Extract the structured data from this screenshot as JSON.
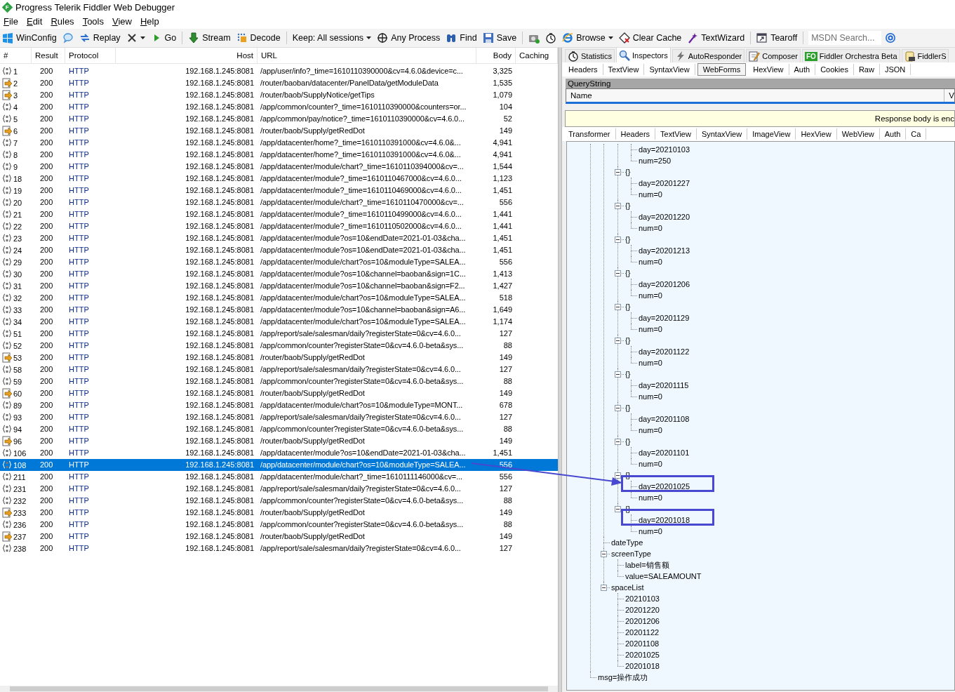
{
  "window": {
    "title": "Progress Telerik Fiddler Web Debugger",
    "icon_text": "F"
  },
  "menu": [
    "File",
    "Edit",
    "Rules",
    "Tools",
    "View",
    "Help"
  ],
  "toolbar": [
    {
      "kind": "button",
      "label": "WinConfig",
      "dropdown": false
    },
    {
      "kind": "button",
      "dropdown": false
    },
    {
      "kind": "button",
      "label": "Replay",
      "dropdown": false
    },
    {
      "kind": "button",
      "dropdown": true
    },
    {
      "kind": "button",
      "label": "Go",
      "dropdown": false
    },
    {
      "kind": "separator"
    },
    {
      "kind": "button",
      "label": "Stream",
      "dropdown": false
    },
    {
      "kind": "button",
      "label": "Decode",
      "dropdown": false
    },
    {
      "kind": "separator"
    },
    {
      "kind": "button",
      "label": "Keep: All sessions",
      "dropdown": true
    },
    {
      "kind": "button",
      "label": "Any Process",
      "dropdown": false
    },
    {
      "kind": "button",
      "label": "Find",
      "dropdown": false
    },
    {
      "kind": "button",
      "label": "Save",
      "dropdown": false
    },
    {
      "kind": "separator"
    },
    {
      "kind": "button",
      "dropdown": false
    },
    {
      "kind": "button",
      "dropdown": false
    },
    {
      "kind": "button",
      "label": "Browse",
      "dropdown": true
    },
    {
      "kind": "button",
      "label": "Clear Cache",
      "dropdown": false
    },
    {
      "kind": "button",
      "label": "TextWizard",
      "dropdown": false
    },
    {
      "kind": "separator"
    },
    {
      "kind": "button",
      "label": "Tearoff",
      "dropdown": false
    },
    {
      "kind": "separator"
    },
    {
      "kind": "search",
      "placeholder": "MSDN Search..."
    },
    {
      "kind": "button",
      "dropdown": false
    }
  ],
  "sessions": {
    "columns": [
      "#",
      "Result",
      "Protocol",
      "Host",
      "URL",
      "Body",
      "Caching"
    ],
    "rows": [
      {
        "kind": "script",
        "number": "1",
        "result": "200",
        "protocol": "HTTP",
        "host": "192.168.1.245:8081",
        "url": "/app/user/info?_time=1610110390000&cv=4.6.0&device=c...",
        "body": "3,325",
        "selected": false
      },
      {
        "kind": "response",
        "number": "2",
        "result": "200",
        "protocol": "HTTP",
        "host": "192.168.1.245:8081",
        "url": "/router/baoban/datacenter/PanelData/getModuleData",
        "body": "1,535",
        "selected": false
      },
      {
        "kind": "response",
        "number": "3",
        "result": "200",
        "protocol": "HTTP",
        "host": "192.168.1.245:8081",
        "url": "/router/baob/SupplyNotice/getTips",
        "body": "1,079",
        "selected": false
      },
      {
        "kind": "script",
        "number": "4",
        "result": "200",
        "protocol": "HTTP",
        "host": "192.168.1.245:8081",
        "url": "/app/common/counter?_time=1610110390000&counters=or...",
        "body": "104",
        "selected": false
      },
      {
        "kind": "script",
        "number": "5",
        "result": "200",
        "protocol": "HTTP",
        "host": "192.168.1.245:8081",
        "url": "/app/common/pay/notice?_time=1610110390000&cv=4.6.0...",
        "body": "52",
        "selected": false
      },
      {
        "kind": "response",
        "number": "6",
        "result": "200",
        "protocol": "HTTP",
        "host": "192.168.1.245:8081",
        "url": "/router/baob/Supply/getRedDot",
        "body": "149",
        "selected": false
      },
      {
        "kind": "script",
        "number": "7",
        "result": "200",
        "protocol": "HTTP",
        "host": "192.168.1.245:8081",
        "url": "/app/datacenter/home?_time=1610110391000&cv=4.6.0&...",
        "body": "4,941",
        "selected": false
      },
      {
        "kind": "script",
        "number": "8",
        "result": "200",
        "protocol": "HTTP",
        "host": "192.168.1.245:8081",
        "url": "/app/datacenter/home?_time=1610110391000&cv=4.6.0&...",
        "body": "4,941",
        "selected": false
      },
      {
        "kind": "script",
        "number": "9",
        "result": "200",
        "protocol": "HTTP",
        "host": "192.168.1.245:8081",
        "url": "/app/datacenter/module/chart?_time=1610110394000&cv=...",
        "body": "1,544",
        "selected": false
      },
      {
        "kind": "script",
        "number": "18",
        "result": "200",
        "protocol": "HTTP",
        "host": "192.168.1.245:8081",
        "url": "/app/datacenter/module?_time=1610110467000&cv=4.6.0...",
        "body": "1,123",
        "selected": false
      },
      {
        "kind": "script",
        "number": "19",
        "result": "200",
        "protocol": "HTTP",
        "host": "192.168.1.245:8081",
        "url": "/app/datacenter/module?_time=1610110469000&cv=4.6.0...",
        "body": "1,451",
        "selected": false
      },
      {
        "kind": "script",
        "number": "20",
        "result": "200",
        "protocol": "HTTP",
        "host": "192.168.1.245:8081",
        "url": "/app/datacenter/module/chart?_time=1610110470000&cv=...",
        "body": "556",
        "selected": false
      },
      {
        "kind": "script",
        "number": "21",
        "result": "200",
        "protocol": "HTTP",
        "host": "192.168.1.245:8081",
        "url": "/app/datacenter/module?_time=1610110499000&cv=4.6.0...",
        "body": "1,441",
        "selected": false
      },
      {
        "kind": "script",
        "number": "22",
        "result": "200",
        "protocol": "HTTP",
        "host": "192.168.1.245:8081",
        "url": "/app/datacenter/module?_time=1610110502000&cv=4.6.0...",
        "body": "1,441",
        "selected": false
      },
      {
        "kind": "script",
        "number": "23",
        "result": "200",
        "protocol": "HTTP",
        "host": "192.168.1.245:8081",
        "url": "/app/datacenter/module?os=10&endDate=2021-01-03&cha...",
        "body": "1,451",
        "selected": false
      },
      {
        "kind": "script",
        "number": "24",
        "result": "200",
        "protocol": "HTTP",
        "host": "192.168.1.245:8081",
        "url": "/app/datacenter/module?os=10&endDate=2021-01-03&cha...",
        "body": "1,451",
        "selected": false
      },
      {
        "kind": "script",
        "number": "29",
        "result": "200",
        "protocol": "HTTP",
        "host": "192.168.1.245:8081",
        "url": "/app/datacenter/module/chart?os=10&moduleType=SALEA...",
        "body": "556",
        "selected": false
      },
      {
        "kind": "script",
        "number": "30",
        "result": "200",
        "protocol": "HTTP",
        "host": "192.168.1.245:8081",
        "url": "/app/datacenter/module?os=10&channel=baoban&sign=1C...",
        "body": "1,413",
        "selected": false
      },
      {
        "kind": "script",
        "number": "31",
        "result": "200",
        "protocol": "HTTP",
        "host": "192.168.1.245:8081",
        "url": "/app/datacenter/module?os=10&channel=baoban&sign=F2...",
        "body": "1,427",
        "selected": false
      },
      {
        "kind": "script",
        "number": "32",
        "result": "200",
        "protocol": "HTTP",
        "host": "192.168.1.245:8081",
        "url": "/app/datacenter/module/chart?os=10&moduleType=SALEA...",
        "body": "518",
        "selected": false
      },
      {
        "kind": "script",
        "number": "33",
        "result": "200",
        "protocol": "HTTP",
        "host": "192.168.1.245:8081",
        "url": "/app/datacenter/module?os=10&channel=baoban&sign=A6...",
        "body": "1,649",
        "selected": false
      },
      {
        "kind": "script",
        "number": "34",
        "result": "200",
        "protocol": "HTTP",
        "host": "192.168.1.245:8081",
        "url": "/app/datacenter/module/chart?os=10&moduleType=SALEA...",
        "body": "1,174",
        "selected": false
      },
      {
        "kind": "script",
        "number": "51",
        "result": "200",
        "protocol": "HTTP",
        "host": "192.168.1.245:8081",
        "url": "/app/report/sale/salesman/daily?registerState=0&cv=4.6.0...",
        "body": "127",
        "selected": false
      },
      {
        "kind": "script",
        "number": "52",
        "result": "200",
        "protocol": "HTTP",
        "host": "192.168.1.245:8081",
        "url": "/app/common/counter?registerState=0&cv=4.6.0-beta&sys...",
        "body": "88",
        "selected": false
      },
      {
        "kind": "response",
        "number": "53",
        "result": "200",
        "protocol": "HTTP",
        "host": "192.168.1.245:8081",
        "url": "/router/baob/Supply/getRedDot",
        "body": "149",
        "selected": false
      },
      {
        "kind": "script",
        "number": "58",
        "result": "200",
        "protocol": "HTTP",
        "host": "192.168.1.245:8081",
        "url": "/app/report/sale/salesman/daily?registerState=0&cv=4.6.0...",
        "body": "127",
        "selected": false
      },
      {
        "kind": "script",
        "number": "59",
        "result": "200",
        "protocol": "HTTP",
        "host": "192.168.1.245:8081",
        "url": "/app/common/counter?registerState=0&cv=4.6.0-beta&sys...",
        "body": "88",
        "selected": false
      },
      {
        "kind": "response",
        "number": "60",
        "result": "200",
        "protocol": "HTTP",
        "host": "192.168.1.245:8081",
        "url": "/router/baob/Supply/getRedDot",
        "body": "149",
        "selected": false
      },
      {
        "kind": "script",
        "number": "89",
        "result": "200",
        "protocol": "HTTP",
        "host": "192.168.1.245:8081",
        "url": "/app/datacenter/module/chart?os=10&moduleType=MONT...",
        "body": "678",
        "selected": false
      },
      {
        "kind": "script",
        "number": "93",
        "result": "200",
        "protocol": "HTTP",
        "host": "192.168.1.245:8081",
        "url": "/app/report/sale/salesman/daily?registerState=0&cv=4.6.0...",
        "body": "127",
        "selected": false
      },
      {
        "kind": "script",
        "number": "94",
        "result": "200",
        "protocol": "HTTP",
        "host": "192.168.1.245:8081",
        "url": "/app/common/counter?registerState=0&cv=4.6.0-beta&sys...",
        "body": "88",
        "selected": false
      },
      {
        "kind": "response",
        "number": "96",
        "result": "200",
        "protocol": "HTTP",
        "host": "192.168.1.245:8081",
        "url": "/router/baob/Supply/getRedDot",
        "body": "149",
        "selected": false
      },
      {
        "kind": "script",
        "number": "106",
        "result": "200",
        "protocol": "HTTP",
        "host": "192.168.1.245:8081",
        "url": "/app/datacenter/module?os=10&endDate=2021-01-03&cha...",
        "body": "1,451",
        "selected": false
      },
      {
        "kind": "script",
        "number": "108",
        "result": "200",
        "protocol": "HTTP",
        "host": "192.168.1.245:8081",
        "url": "/app/datacenter/module/chart?os=10&moduleType=SALEA...",
        "body": "556",
        "selected": true
      },
      {
        "kind": "script",
        "number": "211",
        "result": "200",
        "protocol": "HTTP",
        "host": "192.168.1.245:8081",
        "url": "/app/datacenter/module/chart?_time=1610111146000&cv=...",
        "body": "556",
        "selected": false
      },
      {
        "kind": "script",
        "number": "231",
        "result": "200",
        "protocol": "HTTP",
        "host": "192.168.1.245:8081",
        "url": "/app/report/sale/salesman/daily?registerState=0&cv=4.6.0...",
        "body": "127",
        "selected": false
      },
      {
        "kind": "script",
        "number": "232",
        "result": "200",
        "protocol": "HTTP",
        "host": "192.168.1.245:8081",
        "url": "/app/common/counter?registerState=0&cv=4.6.0-beta&sys...",
        "body": "88",
        "selected": false
      },
      {
        "kind": "response",
        "number": "233",
        "result": "200",
        "protocol": "HTTP",
        "host": "192.168.1.245:8081",
        "url": "/router/baob/Supply/getRedDot",
        "body": "149",
        "selected": false
      },
      {
        "kind": "script",
        "number": "236",
        "result": "200",
        "protocol": "HTTP",
        "host": "192.168.1.245:8081",
        "url": "/app/common/counter?registerState=0&cv=4.6.0-beta&sys...",
        "body": "88",
        "selected": false
      },
      {
        "kind": "response",
        "number": "237",
        "result": "200",
        "protocol": "HTTP",
        "host": "192.168.1.245:8081",
        "url": "/router/baob/Supply/getRedDot",
        "body": "149",
        "selected": false
      },
      {
        "kind": "script",
        "number": "238",
        "result": "200",
        "protocol": "HTTP",
        "host": "192.168.1.245:8081",
        "url": "/app/report/sale/salesman/daily?registerState=0&cv=4.6.0...",
        "body": "127",
        "selected": false
      }
    ]
  },
  "inspector": {
    "tabs": [
      {
        "label": "Statistics",
        "selected": false
      },
      {
        "label": "Inspectors",
        "selected": true
      },
      {
        "label": "AutoResponder",
        "selected": false
      },
      {
        "label": "Composer",
        "selected": false
      },
      {
        "label": "Fiddler Orchestra Beta",
        "badge": "FO",
        "selected": false
      },
      {
        "label": "FiddlerS",
        "selected": false
      }
    ],
    "request_tabs": [
      {
        "label": "Headers",
        "selected": false
      },
      {
        "label": "TextView",
        "selected": false
      },
      {
        "label": "SyntaxView",
        "selected": false
      },
      {
        "label": "WebForms",
        "selected": true
      },
      {
        "label": "HexView",
        "selected": false
      },
      {
        "label": "Auth",
        "selected": false
      },
      {
        "label": "Cookies",
        "selected": false
      },
      {
        "label": "Raw",
        "selected": false
      },
      {
        "label": "JSON",
        "selected": false
      }
    ],
    "querystring": {
      "title": "QueryString",
      "columns": [
        "Name",
        "V"
      ]
    },
    "response_notice": "Response body is enc",
    "response_tabs": [
      {
        "label": "Transformer",
        "selected": false
      },
      {
        "label": "Headers",
        "selected": false
      },
      {
        "label": "TextView",
        "selected": false
      },
      {
        "label": "SyntaxView",
        "selected": false
      },
      {
        "label": "ImageView",
        "selected": false
      },
      {
        "label": "HexView",
        "selected": false
      },
      {
        "label": "WebView",
        "selected": false
      },
      {
        "label": "Auth",
        "selected": false
      },
      {
        "label": "Ca",
        "selected": false
      }
    ],
    "tree": [
      {
        "expanded": true,
        "children": [
          {
            "expanded": true,
            "children": [
              {
                "expanded": true,
                "children": [
                  {
                    "label": "day=20210103",
                    "annotated": false
                  },
                  {
                    "label": "num=250",
                    "annotated": false
                  }
                ]
              },
              {
                "label": "{}",
                "expanded": true,
                "children": [
                  {
                    "label": "day=20201227",
                    "annotated": false
                  },
                  {
                    "label": "num=0",
                    "annotated": false
                  }
                ]
              },
              {
                "label": "{}",
                "expanded": true,
                "children": [
                  {
                    "label": "day=20201220",
                    "annotated": false
                  },
                  {
                    "label": "num=0",
                    "annotated": false
                  }
                ]
              },
              {
                "label": "{}",
                "expanded": true,
                "children": [
                  {
                    "label": "day=20201213",
                    "annotated": false
                  },
                  {
                    "label": "num=0",
                    "annotated": false
                  }
                ]
              },
              {
                "label": "{}",
                "expanded": true,
                "children": [
                  {
                    "label": "day=20201206",
                    "annotated": false
                  },
                  {
                    "label": "num=0",
                    "annotated": false
                  }
                ]
              },
              {
                "label": "{}",
                "expanded": true,
                "children": [
                  {
                    "label": "day=20201129",
                    "annotated": false
                  },
                  {
                    "label": "num=0",
                    "annotated": false
                  }
                ]
              },
              {
                "label": "{}",
                "expanded": true,
                "children": [
                  {
                    "label": "day=20201122",
                    "annotated": false
                  },
                  {
                    "label": "num=0",
                    "annotated": false
                  }
                ]
              },
              {
                "label": "{}",
                "expanded": true,
                "children": [
                  {
                    "label": "day=20201115",
                    "annotated": false
                  },
                  {
                    "label": "num=0",
                    "annotated": false
                  }
                ]
              },
              {
                "label": "{}",
                "expanded": true,
                "children": [
                  {
                    "label": "day=20201108",
                    "annotated": false
                  },
                  {
                    "label": "num=0",
                    "annotated": false
                  }
                ]
              },
              {
                "label": "{}",
                "expanded": true,
                "children": [
                  {
                    "label": "day=20201101",
                    "annotated": false
                  },
                  {
                    "label": "num=0",
                    "annotated": false
                  }
                ]
              },
              {
                "label": "{}",
                "expanded": true,
                "children": [
                  {
                    "label": "day=20201025",
                    "annotated": true
                  },
                  {
                    "label": "num=0",
                    "annotated": false
                  }
                ]
              },
              {
                "label": "{}",
                "expanded": true,
                "children": [
                  {
                    "label": "day=20201018",
                    "annotated": true
                  },
                  {
                    "label": "num=0",
                    "annotated": false
                  }
                ]
              }
            ]
          },
          {
            "label": "dateType"
          },
          {
            "label": "screenType",
            "expanded": true,
            "children": [
              {
                "label": "label=销售额"
              },
              {
                "label": "value=SALEAMOUNT"
              }
            ]
          },
          {
            "label": "spaceList",
            "expanded": true,
            "children": [
              {
                "label": "20210103"
              },
              {
                "label": "20201220"
              },
              {
                "label": "20201206"
              },
              {
                "label": "20201122"
              },
              {
                "label": "20201108"
              },
              {
                "label": "20201025"
              },
              {
                "label": "20201018"
              }
            ]
          }
        ]
      },
      {
        "label": "msg=操作成功"
      }
    ]
  },
  "annotation_arrow": true
}
